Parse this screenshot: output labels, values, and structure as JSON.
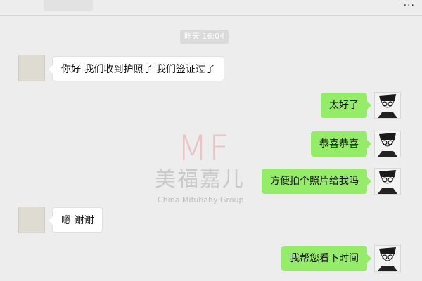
{
  "header": {
    "menu_icon": "more-dots-icon"
  },
  "timestamp": "昨天 16:04",
  "messages": [
    {
      "side": "left",
      "text": "你好 我们收到护照了 我们签证过了"
    },
    {
      "side": "right",
      "text": "太好了"
    },
    {
      "side": "right",
      "text": "恭喜恭喜"
    },
    {
      "side": "right",
      "text": "方便拍个照片给我吗"
    },
    {
      "side": "left",
      "text": "嗯 谢谢"
    },
    {
      "side": "right",
      "text": "我帮您看下时间"
    }
  ],
  "watermark": {
    "logo": "MF",
    "name_cn": "美福嘉儿",
    "name_en": "China Mifubaby Group"
  },
  "colors": {
    "background": "#ededed",
    "sent_bubble": "#95ec69",
    "received_bubble": "#ffffff",
    "timestamp_bg": "#dadada"
  }
}
